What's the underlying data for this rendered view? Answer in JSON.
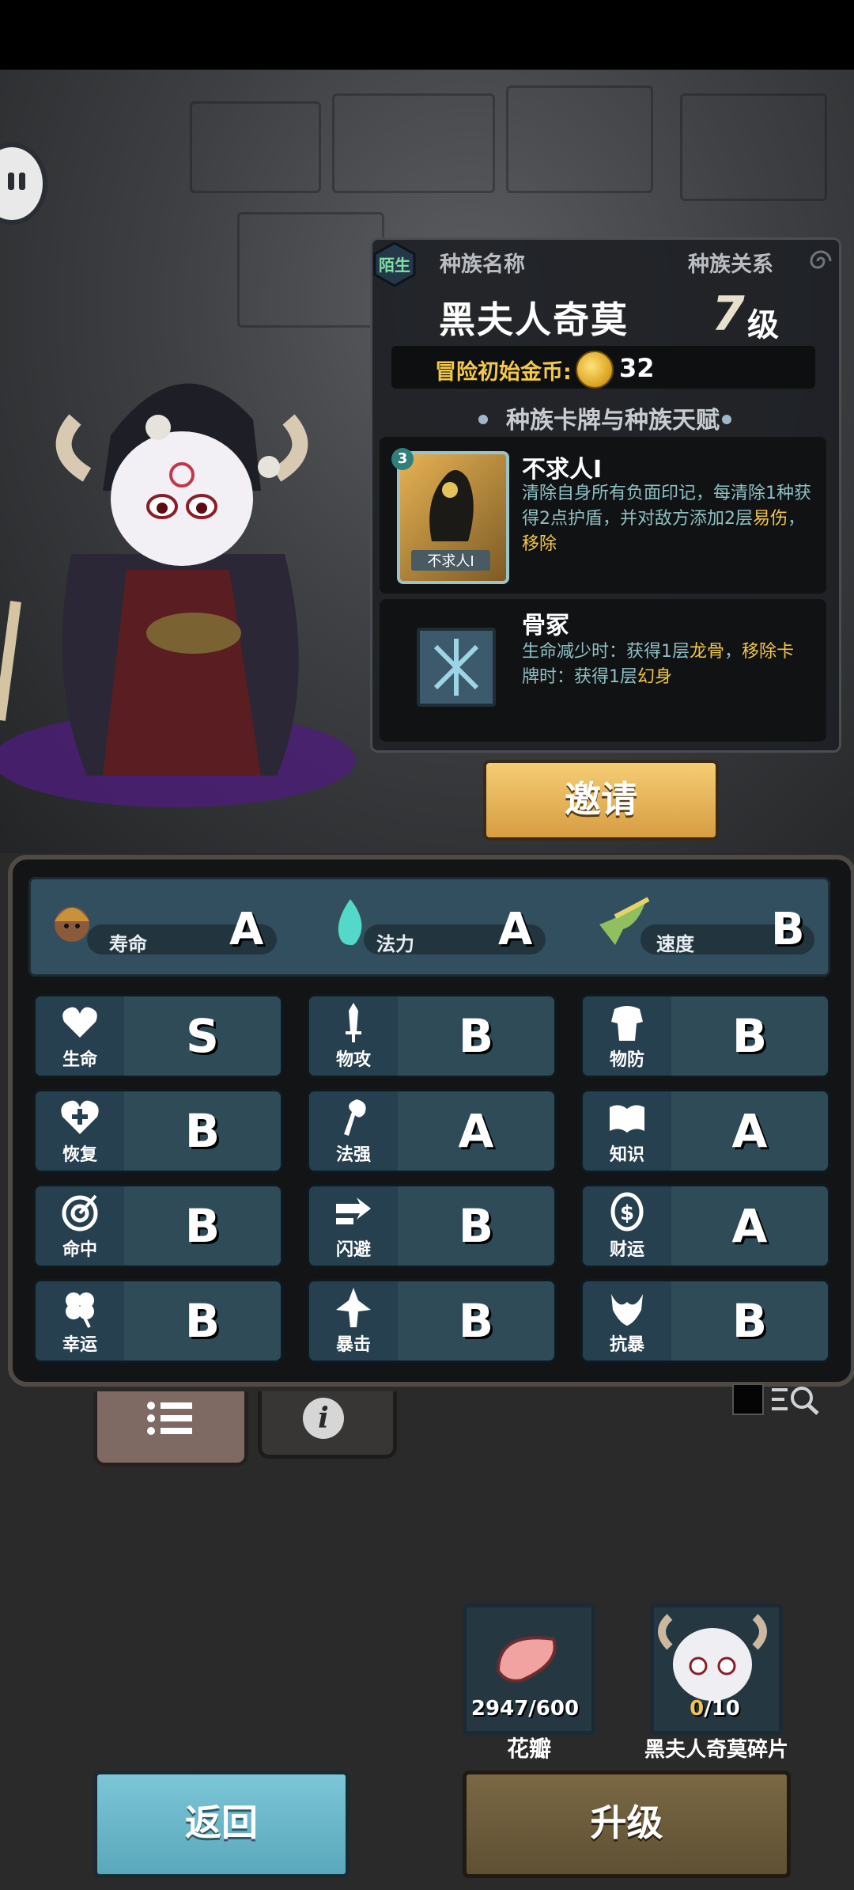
{
  "header": {
    "relation_badge": "陌生",
    "race_name_label": "种族名称",
    "race_relation_label": "种族关系",
    "race_name": "黑夫人奇莫",
    "level": "7",
    "level_unit": "级",
    "gold_label": "冒险初始金币:",
    "gold_value": "32",
    "section_title": "种族卡牌与种族天赋"
  },
  "cards": [
    {
      "cost": "3",
      "art_label": "不求人I",
      "title": "不求人I",
      "desc_parts": [
        "清除自身所有负面印记，每清除1种获得2点护盾，并对敌方添加2层",
        "易伤",
        "，",
        "移除"
      ]
    },
    {
      "title": "骨冢",
      "desc_parts": [
        "生命减少时：获得1层",
        "龙骨",
        "，",
        "移除卡",
        "牌时：获得1层",
        "幻身"
      ]
    }
  ],
  "invite_label": "邀请",
  "top_stats": [
    {
      "label": "寿命",
      "grade": "A",
      "icon": "lifespan-icon"
    },
    {
      "label": "法力",
      "grade": "A",
      "icon": "mana-flame-icon"
    },
    {
      "label": "速度",
      "grade": "B",
      "icon": "wing-boot-icon"
    }
  ],
  "stats": [
    {
      "label": "生命",
      "grade": "S",
      "icon": "heart-icon"
    },
    {
      "label": "物攻",
      "grade": "B",
      "icon": "sword-icon"
    },
    {
      "label": "物防",
      "grade": "B",
      "icon": "armor-icon"
    },
    {
      "label": "恢复",
      "grade": "B",
      "icon": "heart-plus-icon"
    },
    {
      "label": "法强",
      "grade": "A",
      "icon": "staff-icon"
    },
    {
      "label": "知识",
      "grade": "A",
      "icon": "book-icon"
    },
    {
      "label": "命中",
      "grade": "B",
      "icon": "target-icon"
    },
    {
      "label": "闪避",
      "grade": "B",
      "icon": "dodge-arrow-icon"
    },
    {
      "label": "财运",
      "grade": "A",
      "icon": "coin-icon"
    },
    {
      "label": "幸运",
      "grade": "B",
      "icon": "clover-icon"
    },
    {
      "label": "暴击",
      "grade": "B",
      "icon": "crit-blade-icon"
    },
    {
      "label": "抗暴",
      "grade": "B",
      "icon": "shield-claw-icon"
    }
  ],
  "items": [
    {
      "name": "花瓣",
      "count_have": "2947",
      "count_need": "/600"
    },
    {
      "name": "黑夫人奇莫碎片",
      "count_have": "0",
      "count_need": "/10"
    }
  ],
  "buttons": {
    "back": "返回",
    "upgrade": "升级"
  },
  "colors": {
    "highlight": "#f0c64a",
    "desc": "#8fc0c4",
    "gold": "#f4c84b"
  }
}
